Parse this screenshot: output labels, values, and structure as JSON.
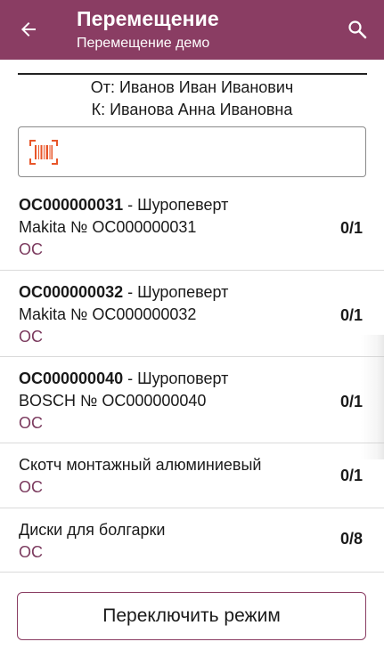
{
  "appbar": {
    "title": "Перемещение",
    "subtitle": "Перемещение демо",
    "back_icon": "arrow-left-icon",
    "search_icon": "search-icon",
    "color": "#8a3d63"
  },
  "route": {
    "from": "От: Иванов Иван Иванович",
    "to": "К: Иванова Анна Ивановна"
  },
  "scan": {
    "icon": "barcode-scan-icon",
    "value": "",
    "icon_color": "#e8562a"
  },
  "items": [
    {
      "code": "ОС000000031",
      "name": " - Шуропеверт",
      "line2": "Makita № ОС000000031",
      "category": "ОС",
      "qty": "0/1"
    },
    {
      "code": "ОС000000032",
      "name": " - Шуропеверт",
      "line2": "Makita № ОС000000032",
      "category": "ОС",
      "qty": "0/1"
    },
    {
      "code": "ОС000000040",
      "name": " - Шуроповерт",
      "line2": "BOSCH № ОС000000040",
      "category": "ОС",
      "qty": "0/1"
    },
    {
      "name": "Скотч монтажный алюминиевый",
      "category": "ОС",
      "qty": "0/1"
    },
    {
      "name": "Диски для болгарки",
      "category": "ОС",
      "qty": "0/8"
    }
  ],
  "switch_button": "Переключить режим"
}
